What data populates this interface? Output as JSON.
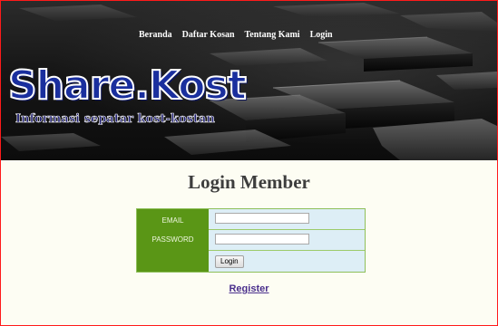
{
  "nav": {
    "items": [
      {
        "label": "Beranda"
      },
      {
        "label": "Daftar Kosan"
      },
      {
        "label": "Tentang Kami"
      },
      {
        "label": "Login"
      }
    ]
  },
  "logo": {
    "title": "Share.Kost",
    "subtitle": "Informasi sepatar kost-kostan"
  },
  "main": {
    "title": "Login Member",
    "form": {
      "email_label": "EMAIL",
      "email_value": "",
      "password_label": "PASSWORD",
      "password_value": "",
      "login_button": "Login"
    },
    "register_link": "Register"
  },
  "colors": {
    "frame_border": "#ff1a1a",
    "label_column": "#5a9616",
    "form_background": "#ddeef6",
    "register_link": "#4a2f8c",
    "logo_blue": "#1a2f9e"
  }
}
